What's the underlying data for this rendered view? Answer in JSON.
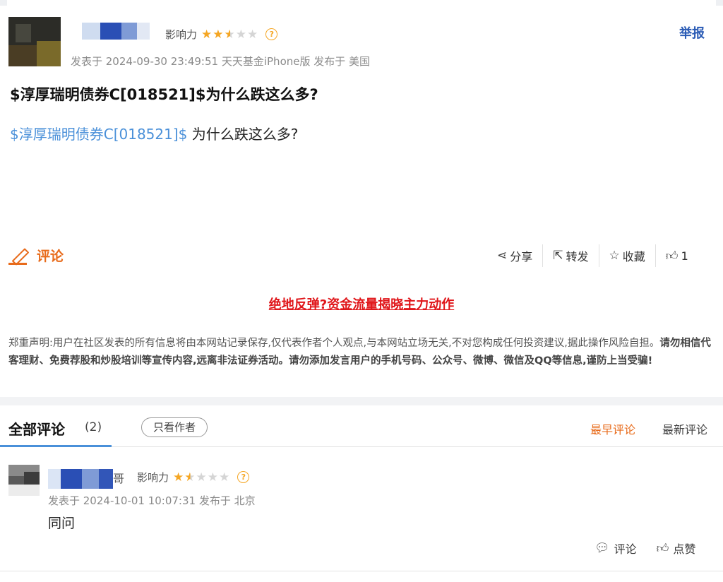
{
  "post": {
    "influence_label": "影响力",
    "influence_stars": 2.5,
    "report_label": "举报",
    "meta": "发表于 2024-09-30 23:49:51 天天基金iPhone版 发布于 美国",
    "title": "$淳厚瑞明债券C[018521]$为什么跌这么多?",
    "body_link": "$淳厚瑞明债券C[018521]$",
    "body_rest": " 为什么跌这么多?",
    "comment_label": "评论",
    "actions": {
      "share": "分享",
      "forward": "转发",
      "favorite": "收藏",
      "like_count": "1"
    }
  },
  "promo": "绝地反弹?资金流量揭晓主力动作",
  "disclaimer": {
    "normal": "郑重声明:用户在社区发表的所有信息将由本网站记录保存,仅代表作者个人观点,与本网站立场无关,不对您构成任何投资建议,据此操作风险自担。",
    "bold": "请勿相信代客理财、免费荐股和炒股培训等宣传内容,远离非法证券活动。请勿添加发言用户的手机号码、公众号、微博、微信及QQ等信息,谨防上当受骗!"
  },
  "comments_section": {
    "all_label": "全部评论",
    "count": "(2)",
    "only_author": "只看作者",
    "sort_earliest": "最早评论",
    "sort_newest": "最新评论"
  },
  "comment": {
    "name_fragment": "哥",
    "influence_label": "影响力",
    "influence_stars": 1.5,
    "meta": "发表于 2024-10-01 10:07:31 发布于 北京",
    "text": "同问",
    "reply_label": "评论",
    "like_label": "点赞"
  },
  "colors": {
    "accent_orange": "#e86b1b",
    "link_blue": "#4a90d9",
    "report_blue": "#2a5bb5",
    "promo_red": "#e0161a",
    "star": "#f5a623"
  }
}
